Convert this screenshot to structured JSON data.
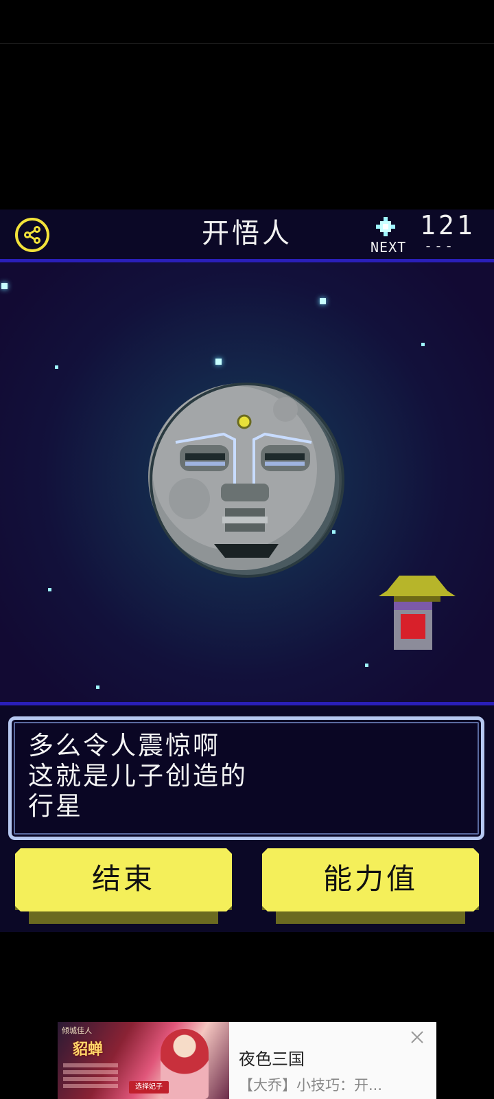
{
  "header": {
    "title": "开悟人",
    "counter": "121",
    "next_label": "NEXT",
    "next_value": "---"
  },
  "dialog": {
    "lines": [
      "多么令人震惊啊",
      "这就是儿子创造的",
      "行星"
    ]
  },
  "buttons": {
    "end_label": "结束",
    "stats_label": "能力值"
  },
  "ad": {
    "title": "夜色三国",
    "subtitle": "【大乔】小技巧：开...",
    "image_brand": "倾城佳人",
    "image_hero": "貂蝉",
    "image_cta": "选择妃子"
  },
  "colors": {
    "accent_yellow": "#f4ef5a",
    "header_bg": "#0b0826",
    "rule_blue": "#2a1fb8",
    "dialog_border": "#b6c8f0"
  },
  "icons": {
    "share": "share-icon",
    "gem": "sparkle-gem-icon",
    "close": "close-icon"
  }
}
